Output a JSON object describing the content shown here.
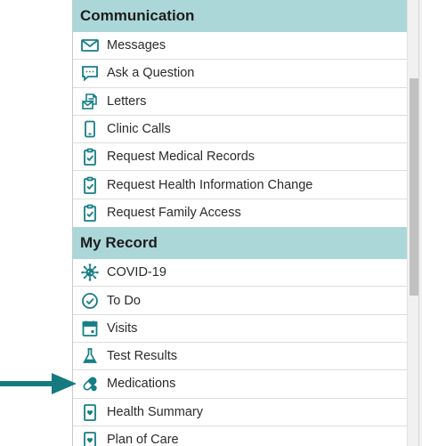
{
  "colors": {
    "accent": "#167e86",
    "section_header_bg": "#acd7d9",
    "arrow": "#157a80"
  },
  "sections": [
    {
      "title": "Communication",
      "items": [
        {
          "label": "Messages",
          "icon": "envelope-icon"
        },
        {
          "label": "Ask a Question",
          "icon": "speech-bubble-icon"
        },
        {
          "label": "Letters",
          "icon": "letters-icon"
        },
        {
          "label": "Clinic Calls",
          "icon": "mobile-phone-icon"
        },
        {
          "label": "Request Medical Records",
          "icon": "clipboard-check-icon"
        },
        {
          "label": "Request Health Information Change",
          "icon": "clipboard-check-icon"
        },
        {
          "label": "Request Family Access",
          "icon": "clipboard-check-icon"
        }
      ]
    },
    {
      "title": "My Record",
      "items": [
        {
          "label": "COVID-19",
          "icon": "virus-icon"
        },
        {
          "label": "To Do",
          "icon": "check-circle-icon"
        },
        {
          "label": "Visits",
          "icon": "calendar-icon"
        },
        {
          "label": "Test Results",
          "icon": "flask-icon"
        },
        {
          "label": "Medications",
          "icon": "pill-capsule-icon"
        },
        {
          "label": "Health Summary",
          "icon": "health-summary-icon"
        },
        {
          "label": "Plan of Care",
          "icon": "plan-of-care-icon"
        }
      ]
    }
  ]
}
